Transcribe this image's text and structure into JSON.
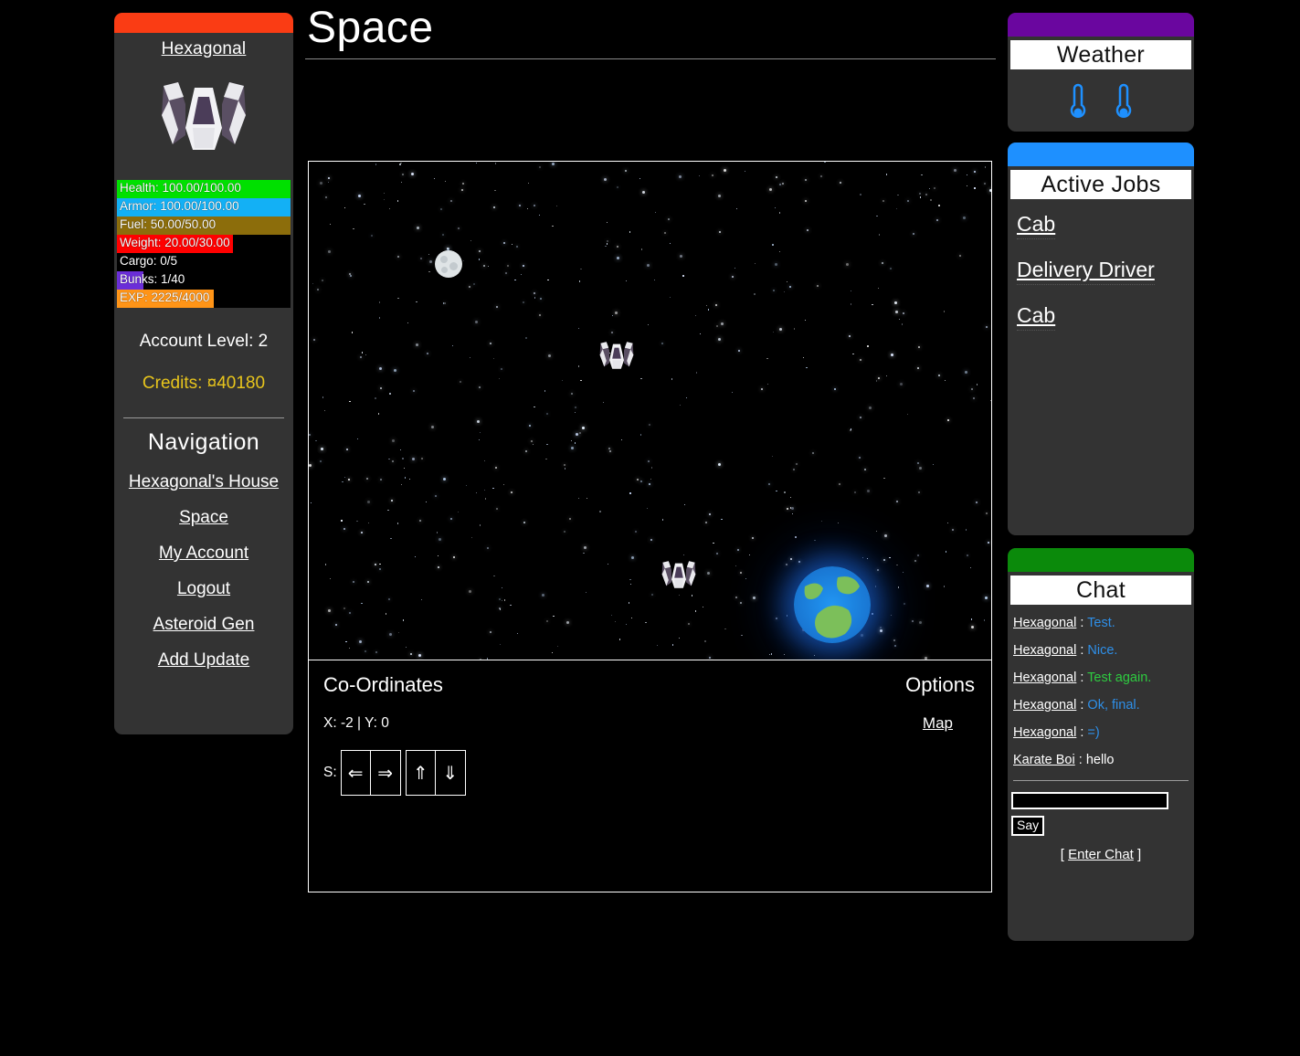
{
  "page": {
    "title": "Space"
  },
  "sidebar": {
    "topbar_color": "#FA3C14",
    "username": "Hexagonal",
    "avatar_icon": "spaceship-icon",
    "stats": [
      {
        "label": "Health: 100.00/100.00",
        "percent": 100,
        "color": "#00E000",
        "name": "health"
      },
      {
        "label": "Armor: 100.00/100.00",
        "percent": 100,
        "color": "#13B0F5",
        "name": "armor"
      },
      {
        "label": "Fuel: 50.00/50.00",
        "percent": 100,
        "color": "#8C6D0B",
        "name": "fuel"
      },
      {
        "label": "Weight: 20.00/30.00",
        "percent": 66.7,
        "color": "#FF0000",
        "name": "weight"
      },
      {
        "label": "Cargo: 0/5",
        "percent": 0,
        "color": "#777777",
        "name": "cargo"
      },
      {
        "label": "Bunks: 1/40",
        "percent": 15,
        "color": "#6A2ED8",
        "name": "bunks"
      },
      {
        "label": "EXP: 2225/4000",
        "percent": 55.6,
        "color": "#FF9417",
        "name": "exp"
      }
    ],
    "account_level": "Account Level: 2",
    "credits": "Credits: ¤40180",
    "credits_color": "#E8C51C",
    "nav_title": "Navigation",
    "nav_items": [
      {
        "label": "Hexagonal's House"
      },
      {
        "label": "Space"
      },
      {
        "label": "My Account"
      },
      {
        "label": "Logout"
      },
      {
        "label": "Asteroid Gen"
      },
      {
        "label": "Add Update"
      }
    ]
  },
  "space": {
    "coordinates_heading": "Co-Ordinates",
    "coordinates_value": "X: -2 | Y: 0",
    "options_heading": "Options",
    "map_link": "Map",
    "speed_label": "S:",
    "move_buttons": [
      {
        "glyph": "⇐",
        "name": "move-left-button"
      },
      {
        "glyph": "⇒",
        "name": "move-right-button"
      },
      {
        "glyph": "⇑",
        "name": "move-up-button"
      },
      {
        "glyph": "⇓",
        "name": "move-down-button"
      }
    ]
  },
  "weather": {
    "header_color": "#6A069F",
    "title": "Weather",
    "icons": [
      "thermometer-icon",
      "thermometer-icon"
    ],
    "icon_color": "#1E90FF"
  },
  "jobs": {
    "header_color": "#1E90FF",
    "title": "Active Jobs",
    "items": [
      {
        "label": "Cab"
      },
      {
        "label": "Delivery Driver"
      },
      {
        "label": "Cab"
      }
    ]
  },
  "chat": {
    "header_color": "#0B8A0B",
    "title": "Chat",
    "separator": " : ",
    "messages": [
      {
        "user": "Hexagonal",
        "text": "Test.",
        "color": "#2E8FE8"
      },
      {
        "user": "Hexagonal",
        "text": "Nice.",
        "color": "#2E8FE8"
      },
      {
        "user": "Hexagonal",
        "text": "Test again.",
        "color": "#2ECC40"
      },
      {
        "user": "Hexagonal",
        "text": "Ok, final.",
        "color": "#2E8FE8"
      },
      {
        "user": "Hexagonal",
        "text": "=)",
        "color": "#2E8FE8"
      },
      {
        "user": "Karate Boi",
        "text": "hello",
        "color": "#FFFFFF"
      }
    ],
    "input_value": "",
    "input_placeholder": "",
    "say_label": "Say",
    "enter_chat_prefix": "[ ",
    "enter_chat_label": "Enter Chat",
    "enter_chat_suffix": " ]"
  }
}
